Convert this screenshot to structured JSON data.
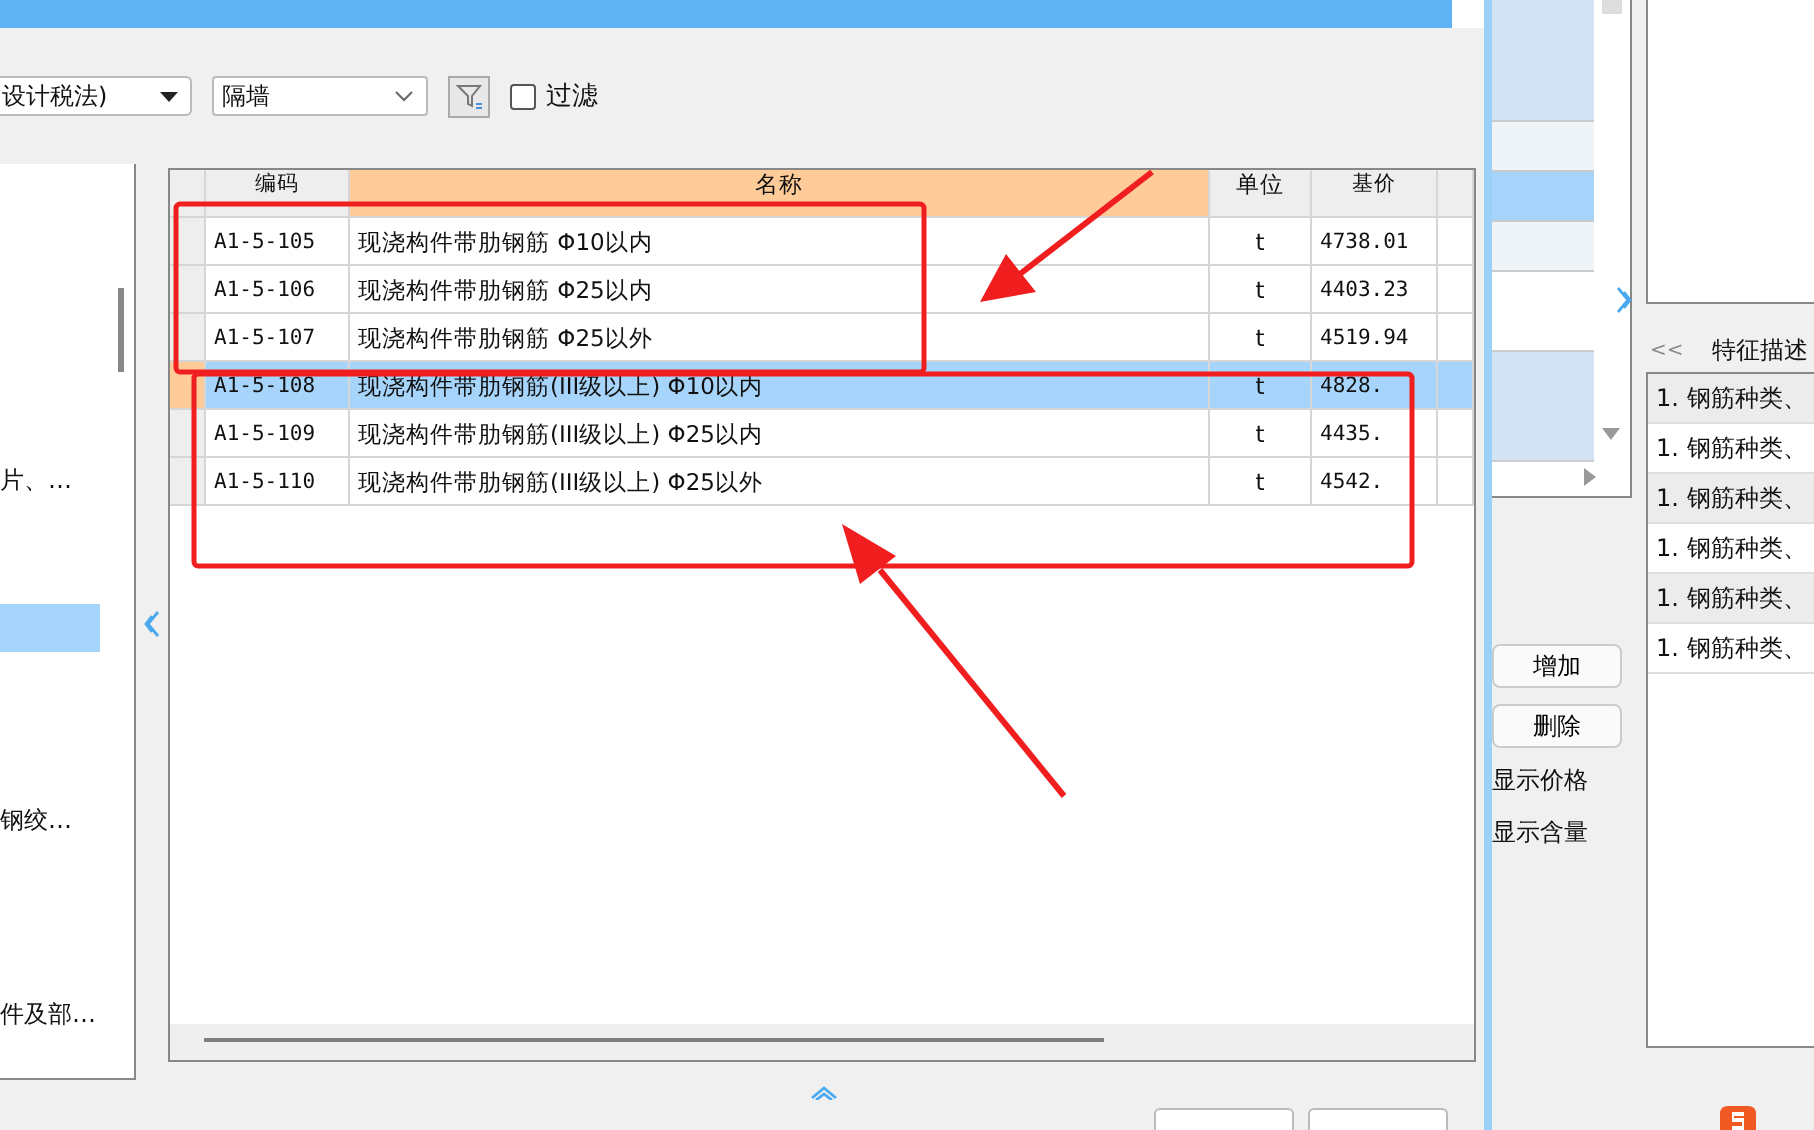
{
  "toolbar": {
    "quota_set": "设计税法)",
    "category": "隔墙",
    "filter_label": "过滤",
    "filter_checked": false
  },
  "tree": [
    {
      "label": "片、…",
      "selected": false
    },
    {
      "selected": true
    },
    {
      "label": "钢绞…",
      "selected": false
    },
    {
      "label": "件及部…",
      "selected": false
    }
  ],
  "table": {
    "columns": [
      "编码",
      "名称",
      "单位",
      "基价"
    ],
    "rows": [
      {
        "code": "A1-5-105",
        "name": "现浇构件带肋钢筋 Φ10以内",
        "unit": "t",
        "price": "4738.01",
        "selected": false
      },
      {
        "code": "A1-5-106",
        "name": "现浇构件带肋钢筋 Φ25以内",
        "unit": "t",
        "price": "4403.23",
        "selected": false
      },
      {
        "code": "A1-5-107",
        "name": "现浇构件带肋钢筋 Φ25以外",
        "unit": "t",
        "price": "4519.94",
        "selected": false
      },
      {
        "code": "A1-5-108",
        "name": "现浇构件带肋钢筋(III级以上) Φ10以内",
        "unit": "t",
        "price": "4828.",
        "selected": true
      },
      {
        "code": "A1-5-109",
        "name": "现浇构件带肋钢筋(III级以上) Φ25以内",
        "unit": "t",
        "price": "4435.",
        "selected": false
      },
      {
        "code": "A1-5-110",
        "name": "现浇构件带肋钢筋(III级以上) Φ25以外",
        "unit": "t",
        "price": "4542.",
        "selected": false
      }
    ]
  },
  "side_list": [
    {
      "selected": false
    },
    {
      "selected": false
    },
    {
      "selected": true
    },
    {
      "selected": false
    },
    {
      "selected": false
    },
    {
      "selected": false
    }
  ],
  "side_buttons": [
    "增加",
    "删除"
  ],
  "side_options": [
    "显示价格",
    "显示含量"
  ],
  "features": {
    "collapse": "<<",
    "title": "特征描述",
    "items": [
      {
        "text": "1. 钢筋种类、",
        "selected": false
      },
      {
        "text": "1. 钢筋种类、",
        "selected": false
      },
      {
        "text": "1. 钢筋种类、",
        "selected": false
      },
      {
        "text": "1. 钢筋种类、",
        "selected": false
      },
      {
        "text": "1. 钢筋种类、",
        "selected": false
      },
      {
        "text": "1. 钢筋种类、",
        "selected": false
      }
    ]
  }
}
